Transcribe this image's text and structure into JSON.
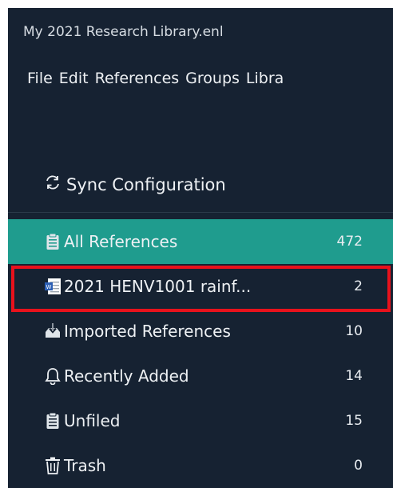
{
  "window": {
    "title": "My 2021 Research Library.enl"
  },
  "menubar": {
    "items": [
      "File",
      "Edit",
      "References",
      "Groups",
      "Libra"
    ]
  },
  "sync": {
    "label": "Sync Configuration",
    "icon": "sync-icon"
  },
  "groups": [
    {
      "label": "All References",
      "count": "472",
      "icon": "clipboard-icon",
      "selected": true
    },
    {
      "label": "2021 HENV1001 rainf...",
      "count": "2",
      "icon": "word-document-icon",
      "selected": false,
      "highlighted": true
    },
    {
      "label": "Imported References",
      "count": "10",
      "icon": "import-tray-icon",
      "selected": false
    },
    {
      "label": "Recently Added",
      "count": "14",
      "icon": "bell-icon",
      "selected": false
    },
    {
      "label": "Unfiled",
      "count": "15",
      "icon": "clipboard-icon",
      "selected": false
    },
    {
      "label": "Trash",
      "count": "0",
      "icon": "trash-icon",
      "selected": false
    }
  ],
  "colors": {
    "background": "#162232",
    "selected_row": "#1f9c8e",
    "highlight_border": "#e8121c",
    "text": "#eef1f4"
  }
}
